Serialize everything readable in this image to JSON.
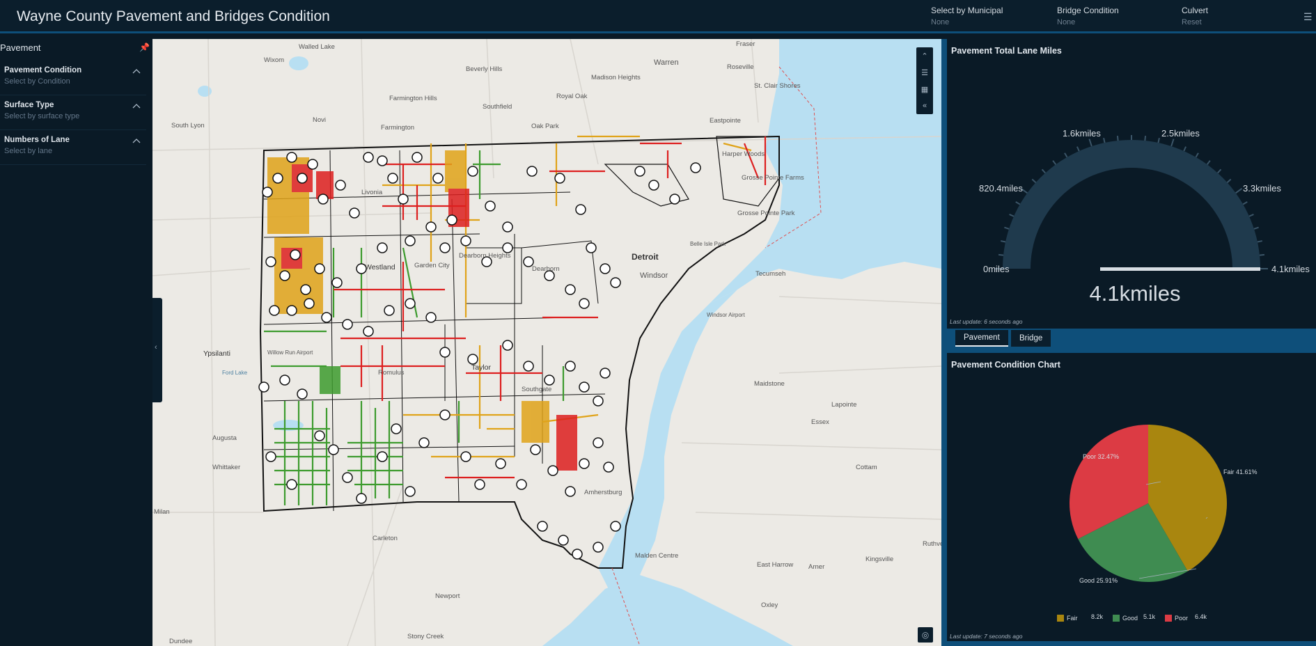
{
  "header": {
    "title": "Wayne County Pavement and Bridges Condition",
    "selectors": [
      {
        "label": "Select by Municipal",
        "value": "None"
      },
      {
        "label": "Bridge Condition",
        "value": "None"
      },
      {
        "label": "Culvert",
        "value": "Reset"
      }
    ],
    "menu_icon": "hamburger-icon"
  },
  "left_panel": {
    "title": "Pavement",
    "pin_icon": "pin-icon",
    "filters": [
      {
        "label": "Pavement Condition",
        "placeholder": "Select by Condition"
      },
      {
        "label": "Surface Type",
        "placeholder": "Select by surface type"
      },
      {
        "label": "Numbers of Lane",
        "placeholder": "Select by lane"
      }
    ]
  },
  "map": {
    "place_labels": [
      "Walled Lake",
      "Wixom",
      "Beverly Hills",
      "Fraser",
      "Warren",
      "Roseville",
      "Madison Heights",
      "Royal Oak",
      "St. Clair Shores",
      "Farmington Hills",
      "Southfield",
      "Novi",
      "Oak Park",
      "Eastpointe",
      "South Lyon",
      "Farmington",
      "Harper Woods",
      "Grosse Pointe Farms",
      "Grosse Pointe Park",
      "Livonia",
      "Westland",
      "Garden City",
      "Dearborn Heights",
      "Dearborn",
      "Detroit",
      "Windsor",
      "Tecumseh",
      "Ypsilanti",
      "Romulus",
      "Taylor",
      "Southgate",
      "Maidstone",
      "Lapointe",
      "Essex",
      "Augusta",
      "Whittaker",
      "Cottam",
      "Milan",
      "Carleton",
      "Amherstburg",
      "Malden Centre",
      "East Harrow",
      "Kingsville",
      "Arner",
      "Oxley",
      "Newport",
      "Stony Creek",
      "Dundee",
      "Ruthven",
      "Belle Isle Park",
      "Windsor Airport",
      "Willow Run Airport",
      "Ford Lake"
    ],
    "tool_icons": [
      "collapse-up-icon",
      "list-icon",
      "grid-icon",
      "double-chevron-left-icon"
    ],
    "locate_icon": "locate-icon",
    "colors": {
      "good": "#3d9b2e",
      "fair": "#e0a319",
      "poor": "#dd1f1f",
      "water": "#b8dff2",
      "land": "#eceae5",
      "boundary": "#111111"
    }
  },
  "gauge": {
    "title": "Pavement Total Lane Miles",
    "tick_labels": [
      "0miles",
      "820.4miles",
      "1.6kmiles",
      "2.5kmiles",
      "3.3kmiles",
      "4.1kmiles"
    ],
    "value_text": "4.1kmiles",
    "value_fraction": 1.0,
    "last_update": "Last update: 6 seconds ago"
  },
  "tabs": [
    {
      "label": "Pavement",
      "active": true
    },
    {
      "label": "Bridge",
      "active": false
    }
  ],
  "pie": {
    "title": "Pavement Condition Chart",
    "last_update": "Last update: 7 seconds ago",
    "slice_labels": [
      "Fair 41.61%",
      "Good 25.91%",
      "Poor 32.47%"
    ],
    "legend": [
      {
        "label": "Fair",
        "value": "8.2k",
        "color": "#a9860f"
      },
      {
        "label": "Good",
        "value": "5.1k",
        "color": "#3f8c51"
      },
      {
        "label": "Poor",
        "value": "6.4k",
        "color": "#dc3b44"
      }
    ]
  },
  "chart_data": {
    "type": "pie",
    "categories": [
      "Fair",
      "Good",
      "Poor"
    ],
    "values": [
      41.61,
      25.91,
      32.47
    ],
    "counts": [
      "8.2k",
      "5.1k",
      "6.4k"
    ],
    "colors": [
      "#a9860f",
      "#3f8c51",
      "#dc3b44"
    ],
    "legend": "bottom"
  }
}
